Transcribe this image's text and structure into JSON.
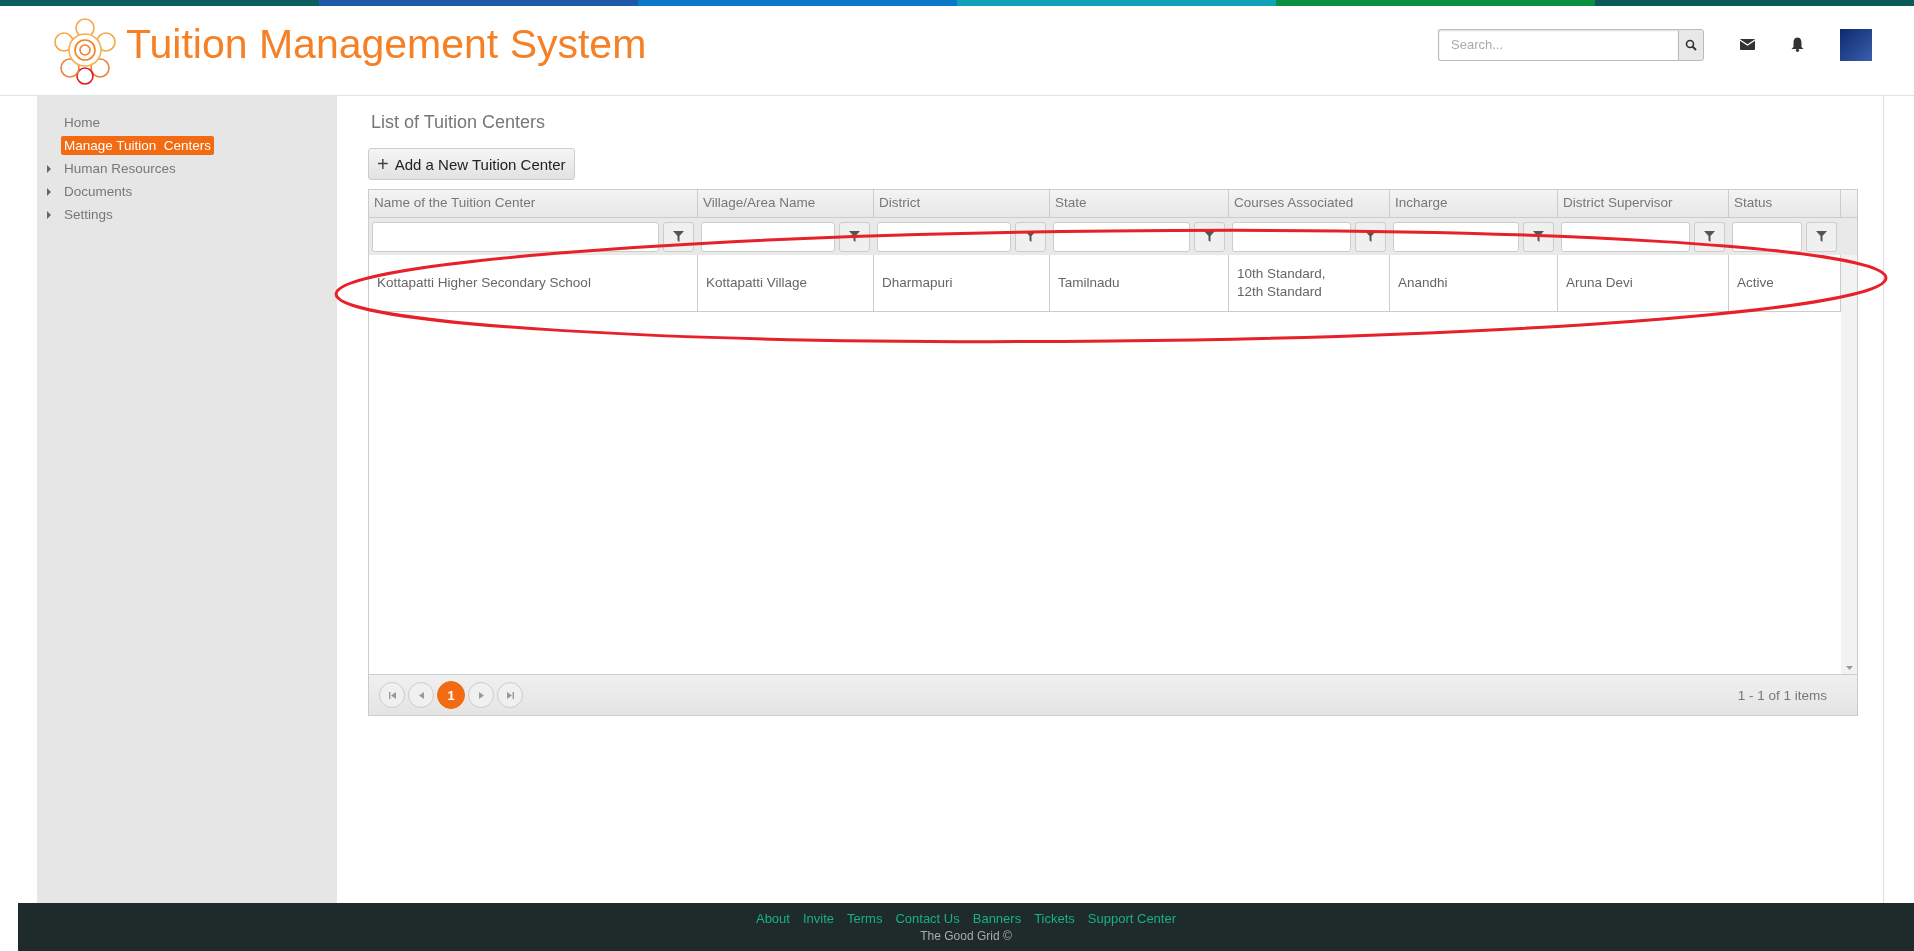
{
  "header": {
    "title": "Tuition Management System",
    "search": {
      "placeholder": "Search..."
    }
  },
  "sidebar": {
    "items": [
      {
        "label": "Home",
        "kind": "link",
        "selected": false
      },
      {
        "label": "Manage Tuition  Centers",
        "kind": "link",
        "selected": true
      },
      {
        "label": "Human Resources",
        "kind": "group",
        "expanded": false,
        "selected": false
      },
      {
        "label": "Documents",
        "kind": "group",
        "expanded": false,
        "selected": false
      },
      {
        "label": "Settings",
        "kind": "group",
        "expanded": false,
        "selected": false
      }
    ]
  },
  "page_title": "List of Tuition Centers",
  "add_button": {
    "icon": "+",
    "label": "Add a New Tuition Center"
  },
  "table": {
    "columns": [
      "Name of the Tuition Center",
      "Village/Area Name",
      "District",
      "State",
      "Courses Associated",
      "Incharge",
      "District Supervisor",
      "Status"
    ],
    "rows": [
      [
        "Kottapatti Higher Secondary School",
        "Kottapatti Village",
        "Dharmapuri",
        "Tamilnadu",
        "10th Standard,\n12th Standard",
        "Anandhi",
        "Aruna Devi",
        "Active"
      ]
    ]
  },
  "annotation": {
    "kind": "ellipse"
  },
  "pager": {
    "pages": [
      {
        "label": "1",
        "selected": true
      }
    ],
    "info": "1 - 1 of 1 items"
  },
  "footer": {
    "links": [
      "About",
      "Invite",
      "Terms",
      "Contact Us",
      "Banners",
      "Tickets",
      "Support Center"
    ],
    "copyright": "The Good Grid ©"
  }
}
